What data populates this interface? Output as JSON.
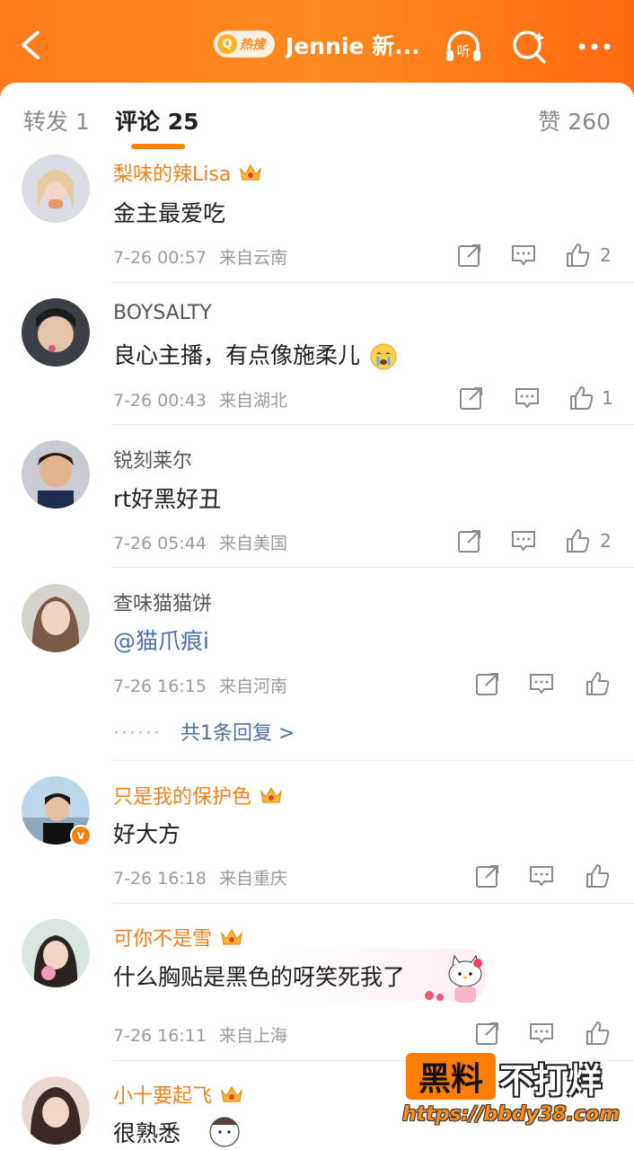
{
  "header": {
    "hot_badge_label": "热搜",
    "title": "Jennie 新...",
    "icons": [
      "back-arrow-icon",
      "listen-icon",
      "search-icon",
      "more-icon"
    ],
    "listen_label": "听"
  },
  "tabs": {
    "repost": "转发 1",
    "comment": "评论 25",
    "like": "赞 260"
  },
  "comments": [
    {
      "username": "梨味的辣Lisa",
      "vip": true,
      "text": "金主最爱吃",
      "time": "7-26 00:57",
      "location": "来自云南",
      "likes": "2"
    },
    {
      "username": "BOYSALTY",
      "vip": false,
      "text": "良心主播，有点像施柔儿",
      "emoji": "crying-face",
      "time": "7-26 00:43",
      "location": "来自湖北",
      "likes": "1"
    },
    {
      "username": "锐刻莱尔",
      "vip": false,
      "text": "rt好黑好丑",
      "time": "7-26 05:44",
      "location": "来自美国",
      "likes": "2"
    },
    {
      "username": "查味猫猫饼",
      "vip": false,
      "text": "@猫爪痕i",
      "time": "7-26 16:15",
      "location": "来自河南",
      "likes": "",
      "reply_link": "共1条回复 >",
      "reply_dots": "······"
    },
    {
      "username": "只是我的保护色",
      "vip": true,
      "verified": true,
      "text": "好大方",
      "time": "7-26 16:18",
      "location": "来自重庆",
      "likes": ""
    },
    {
      "username": "可你不是雪",
      "vip": true,
      "text": "什么胸贴是黑色的呀笑死我了",
      "time": "7-26 16:11",
      "location": "来自上海",
      "likes": ""
    },
    {
      "username": "小十要起飞",
      "vip": true,
      "text": "很熟悉"
    }
  ],
  "watermark": {
    "box": "黑料",
    "text": "不打烊",
    "url": "https://bbdy38.com"
  },
  "colors": {
    "header_orange": "#ff7a1a",
    "vip_name": "#f1801f",
    "tab_underline": "#ff8200",
    "mention_link": "#4a6fa5"
  }
}
